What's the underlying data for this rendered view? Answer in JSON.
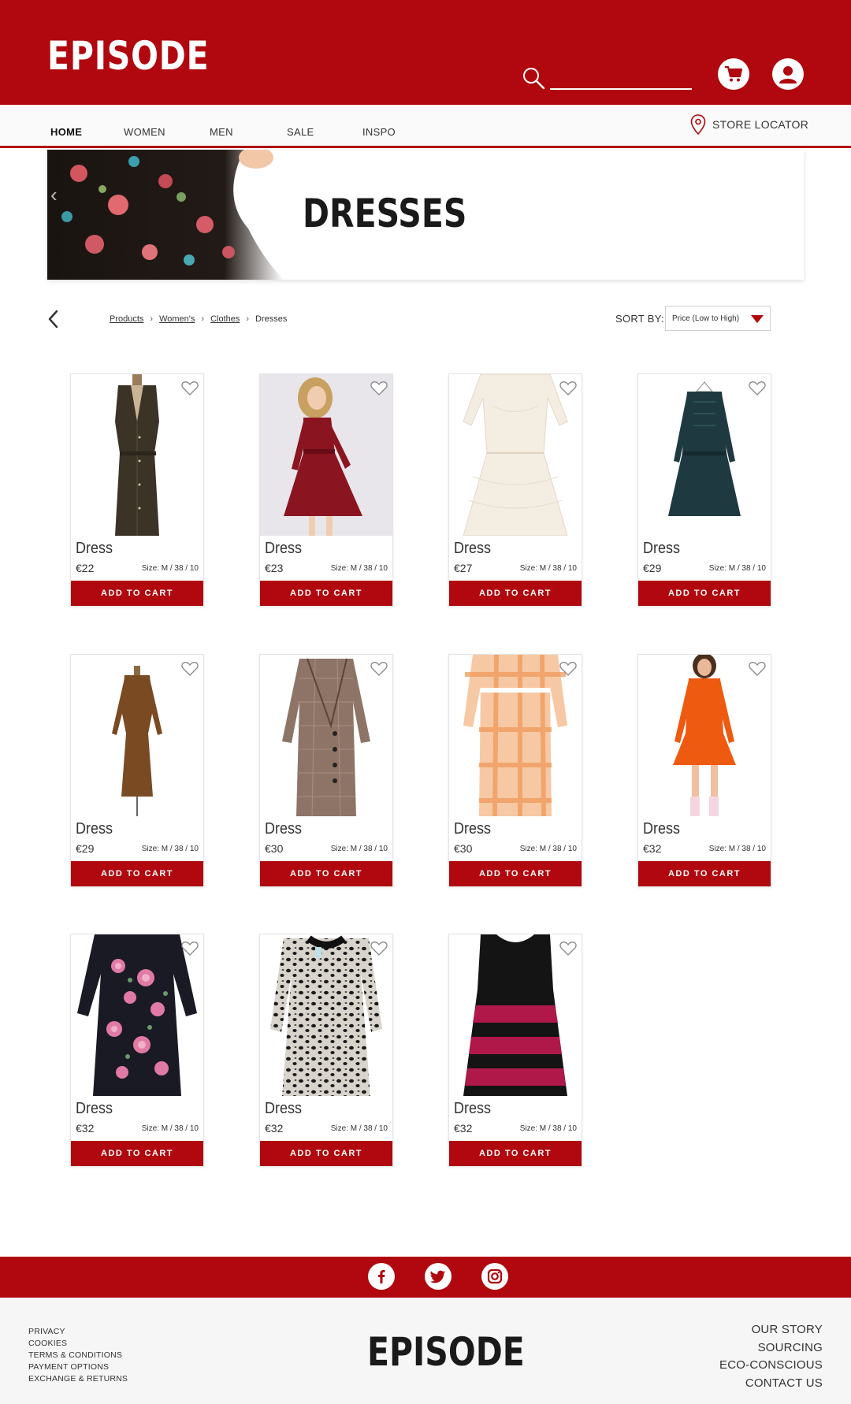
{
  "header": {
    "logo": "EPISODE",
    "search_placeholder": ""
  },
  "nav": {
    "items": [
      "HOME",
      "WOMEN",
      "MEN",
      "SALE",
      "INSPO"
    ],
    "store_locator": "STORE LOCATOR"
  },
  "banner": {
    "title": "DRESSES"
  },
  "breadcrumb": {
    "items": [
      "Products",
      "Women's",
      "Clothes",
      "Dresses"
    ],
    "separator": "›"
  },
  "sort": {
    "label": "SORT BY:",
    "value": "Price (Low to High)"
  },
  "products": [
    {
      "name": "Dress",
      "price": "€22",
      "size": "Size: M / 38 / 10",
      "button": "ADD TO CART"
    },
    {
      "name": "Dress",
      "price": "€23",
      "size": "Size: M / 38 / 10",
      "button": "ADD TO CART"
    },
    {
      "name": "Dress",
      "price": "€27",
      "size": "Size: M / 38 / 10",
      "button": "ADD TO CART"
    },
    {
      "name": "Dress",
      "price": "€29",
      "size": "Size: M / 38 / 10",
      "button": "ADD TO CART"
    },
    {
      "name": "Dress",
      "price": "€29",
      "size": "Size: M / 38 / 10",
      "button": "ADD TO CART"
    },
    {
      "name": "Dress",
      "price": "€30",
      "size": "Size: M / 38 / 10",
      "button": "ADD TO CART"
    },
    {
      "name": "Dress",
      "price": "€30",
      "size": "Size: M / 38 / 10",
      "button": "ADD TO CART"
    },
    {
      "name": "Dress",
      "price": "€32",
      "size": "Size: M / 38 / 10",
      "button": "ADD TO CART"
    },
    {
      "name": "Dress",
      "price": "€32",
      "size": "Size: M / 38 / 10",
      "button": "ADD TO CART"
    },
    {
      "name": "Dress",
      "price": "€32",
      "size": "Size: M / 38 / 10",
      "button": "ADD TO CART"
    },
    {
      "name": "Dress",
      "price": "€32",
      "size": "Size: M / 38 / 10",
      "button": "ADD TO CART"
    }
  ],
  "footer": {
    "left_links": [
      "PRIVACY",
      "COOKIES",
      "TERMS & CONDITIONS",
      "PAYMENT OPTIONS",
      "EXCHANGE & RETURNS"
    ],
    "logo": "EPISODE",
    "right_links": [
      "OUR STORY",
      "SOURCING",
      "ECO-CONSCIOUS",
      "CONTACT US"
    ],
    "social": [
      "facebook-icon",
      "twitter-icon",
      "instagram-icon"
    ]
  },
  "colors": {
    "brand_red": "#b0080e",
    "background": "#ffffff"
  }
}
